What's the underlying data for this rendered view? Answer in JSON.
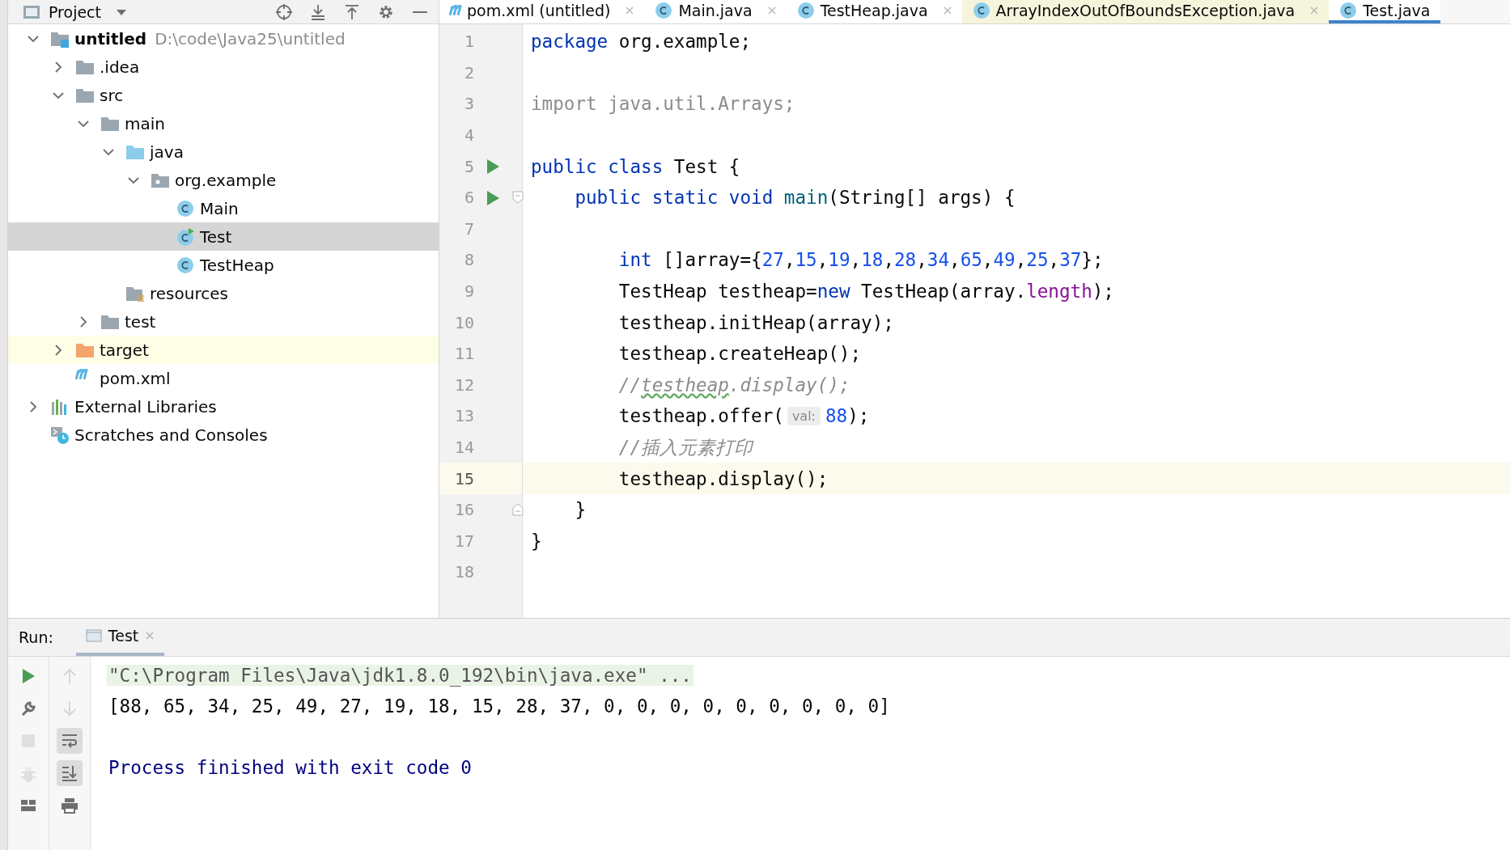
{
  "project_bar": {
    "title": "Project",
    "tools": [
      {
        "kind": "locate"
      },
      {
        "kind": "expand"
      },
      {
        "kind": "collapse"
      },
      {
        "kind": "settings"
      },
      {
        "kind": "hide"
      }
    ]
  },
  "tabs": [
    {
      "label": "pom.xml (untitled)",
      "kind": "maven",
      "selected": false,
      "closable": true,
      "color": "#ffffff"
    },
    {
      "label": "Main.java",
      "kind": "class",
      "selected": false,
      "closable": true,
      "color": "#ffffff"
    },
    {
      "label": "TestHeap.java",
      "kind": "class",
      "selected": false,
      "closable": true,
      "color": "#ffffff"
    },
    {
      "label": "ArrayIndexOutOfBoundsException.java",
      "kind": "class",
      "selected": false,
      "closable": true,
      "color": "#f6f5dc"
    },
    {
      "label": "Test.java",
      "kind": "class",
      "selected": true,
      "closable": false,
      "color": "#ffffff"
    }
  ],
  "tree": [
    {
      "label": "untitled",
      "path": "D:\\code\\Java25\\untitled",
      "kind": "module",
      "expanded": true,
      "selected": false,
      "highlighted": false,
      "children": [
        {
          "label": ".idea",
          "kind": "folder",
          "expanded": false,
          "selected": false,
          "highlighted": false
        },
        {
          "label": "src",
          "kind": "folder",
          "expanded": true,
          "selected": false,
          "highlighted": false,
          "children": [
            {
              "label": "main",
              "kind": "folder",
              "expanded": true,
              "selected": false,
              "highlighted": false,
              "children": [
                {
                  "label": "java",
                  "kind": "source-folder",
                  "expanded": true,
                  "selected": false,
                  "highlighted": false,
                  "children": [
                    {
                      "label": "org.example",
                      "kind": "package",
                      "expanded": true,
                      "selected": false,
                      "highlighted": false,
                      "children": [
                        {
                          "label": "Main",
                          "kind": "class",
                          "selected": false,
                          "highlighted": false
                        },
                        {
                          "label": "Test",
                          "kind": "runnable-class",
                          "selected": true,
                          "highlighted": false
                        },
                        {
                          "label": "TestHeap",
                          "kind": "class",
                          "selected": false,
                          "highlighted": false
                        }
                      ]
                    }
                  ]
                },
                {
                  "label": "resources",
                  "kind": "resources",
                  "selected": false,
                  "highlighted": false
                }
              ]
            },
            {
              "label": "test",
              "kind": "folder",
              "expanded": false,
              "selected": false,
              "highlighted": false
            }
          ]
        },
        {
          "label": "target",
          "kind": "excluded-folder",
          "expanded": false,
          "selected": false,
          "highlighted": true
        },
        {
          "label": "pom.xml",
          "kind": "maven",
          "selected": false,
          "highlighted": false
        }
      ]
    },
    {
      "label": "External Libraries",
      "kind": "libraries",
      "expanded": false,
      "selected": false,
      "highlighted": false
    },
    {
      "label": "Scratches and Consoles",
      "kind": "scratches",
      "selected": false,
      "highlighted": false
    }
  ],
  "editor": {
    "lines": [
      {
        "number": "1",
        "run": false,
        "fold_start": false,
        "fold_end": false,
        "current": false,
        "tokens": [
          {
            "text": "package",
            "kind": "kw"
          },
          {
            "text": " org.example;",
            "kind": "plain"
          }
        ]
      },
      {
        "number": "2",
        "run": false,
        "fold_start": false,
        "fold_end": false,
        "current": false
      },
      {
        "number": "3",
        "run": false,
        "fold_start": false,
        "fold_end": false,
        "current": false,
        "tokens": [
          {
            "text": "import java.util.Arrays;",
            "kind": "unused"
          }
        ]
      },
      {
        "number": "4",
        "run": false,
        "fold_start": false,
        "fold_end": false,
        "current": false
      },
      {
        "number": "5",
        "run": true,
        "fold_start": false,
        "fold_end": false,
        "current": false,
        "tokens": [
          {
            "text": "public class",
            "kind": "kw"
          },
          {
            "text": " Test {",
            "kind": "plain"
          }
        ]
      },
      {
        "number": "6",
        "run": true,
        "fold_start": true,
        "fold_end": false,
        "current": false,
        "tokens": [
          {
            "text": "    public static void",
            "kind": "kw"
          },
          {
            "text": " main",
            "kind": "decl"
          },
          {
            "text": "(String[] args) {",
            "kind": "plain"
          }
        ]
      },
      {
        "number": "7",
        "run": false,
        "fold_start": false,
        "fold_end": false,
        "current": false
      },
      {
        "number": "8",
        "run": false,
        "fold_start": false,
        "fold_end": false,
        "current": false,
        "tokens": [
          {
            "text": "        int",
            "kind": "kw"
          },
          {
            "text": " []array={",
            "kind": "plain"
          },
          {
            "text": "27",
            "kind": "num"
          },
          {
            "text": ",",
            "kind": "plain"
          },
          {
            "text": "15",
            "kind": "num"
          },
          {
            "text": ",",
            "kind": "plain"
          },
          {
            "text": "19",
            "kind": "num"
          },
          {
            "text": ",",
            "kind": "plain"
          },
          {
            "text": "18",
            "kind": "num"
          },
          {
            "text": ",",
            "kind": "plain"
          },
          {
            "text": "28",
            "kind": "num"
          },
          {
            "text": ",",
            "kind": "plain"
          },
          {
            "text": "34",
            "kind": "num"
          },
          {
            "text": ",",
            "kind": "plain"
          },
          {
            "text": "65",
            "kind": "num"
          },
          {
            "text": ",",
            "kind": "plain"
          },
          {
            "text": "49",
            "kind": "num"
          },
          {
            "text": ",",
            "kind": "plain"
          },
          {
            "text": "25",
            "kind": "num"
          },
          {
            "text": ",",
            "kind": "plain"
          },
          {
            "text": "37",
            "kind": "num"
          },
          {
            "text": "};",
            "kind": "plain"
          }
        ]
      },
      {
        "number": "9",
        "run": false,
        "fold_start": false,
        "fold_end": false,
        "current": false,
        "tokens": [
          {
            "text": "        TestHeap testheap=",
            "kind": "plain"
          },
          {
            "text": "new",
            "kind": "kw"
          },
          {
            "text": " TestHeap(array.",
            "kind": "plain"
          },
          {
            "text": "length",
            "kind": "field"
          },
          {
            "text": ");",
            "kind": "plain"
          }
        ]
      },
      {
        "number": "10",
        "run": false,
        "fold_start": false,
        "fold_end": false,
        "current": false,
        "tokens": [
          {
            "text": "        testheap.initHeap(array);",
            "kind": "plain"
          }
        ]
      },
      {
        "number": "11",
        "run": false,
        "fold_start": false,
        "fold_end": false,
        "current": false,
        "tokens": [
          {
            "text": "        testheap.createHeap();",
            "kind": "plain"
          }
        ]
      },
      {
        "number": "12",
        "run": false,
        "fold_start": false,
        "fold_end": false,
        "current": false,
        "tokens": [
          {
            "text": "        //",
            "kind": "comment"
          },
          {
            "text": "testheap",
            "kind": "typo"
          },
          {
            "text": ".display();",
            "kind": "comment"
          }
        ]
      },
      {
        "number": "13",
        "run": false,
        "fold_start": false,
        "fold_end": false,
        "current": false,
        "tokens": [
          {
            "text": "        testheap.offer(",
            "kind": "plain"
          },
          {
            "text": "val:",
            "kind": "hint"
          },
          {
            "text": "88",
            "kind": "num"
          },
          {
            "text": ");",
            "kind": "plain"
          }
        ]
      },
      {
        "number": "14",
        "run": false,
        "fold_start": false,
        "fold_end": false,
        "current": false,
        "tokens": [
          {
            "text": "        //插入元素打印",
            "kind": "comment"
          }
        ]
      },
      {
        "number": "15",
        "run": false,
        "fold_start": false,
        "fold_end": false,
        "current": true,
        "tokens": [
          {
            "text": "        testheap.display();",
            "kind": "plain"
          }
        ]
      },
      {
        "number": "16",
        "run": false,
        "fold_start": false,
        "fold_end": true,
        "current": false,
        "tokens": [
          {
            "text": "    }",
            "kind": "plain"
          }
        ]
      },
      {
        "number": "17",
        "run": false,
        "fold_start": false,
        "fold_end": false,
        "current": false,
        "tokens": [
          {
            "text": "}",
            "kind": "plain"
          }
        ]
      },
      {
        "number": "18",
        "run": false,
        "fold_start": false,
        "fold_end": false,
        "current": false
      }
    ]
  },
  "run_panel": {
    "label": "Run:",
    "tab": {
      "label": "Test",
      "selected": true
    },
    "tools_left": [
      {
        "kind": "run",
        "disabled": false
      },
      {
        "kind": "wrench",
        "disabled": false
      },
      {
        "kind": "stop",
        "disabled": true
      },
      {
        "kind": "debug",
        "disabled": true
      },
      {
        "kind": "layout",
        "disabled": false
      }
    ],
    "tools_right": [
      {
        "kind": "up",
        "disabled": true,
        "pressed": false
      },
      {
        "kind": "down",
        "disabled": true,
        "pressed": false
      },
      {
        "kind": "wrap",
        "disabled": false,
        "pressed": true
      },
      {
        "kind": "scroll-end",
        "disabled": false,
        "pressed": true
      },
      {
        "kind": "print",
        "disabled": false,
        "pressed": false
      }
    ],
    "output": [
      {
        "text": "\"C:\\Program Files\\Java\\jdk1.8.0_192\\bin\\java.exe\" ...",
        "kind": "command"
      },
      {
        "text": "[88, 65, 34, 25, 49, 27, 19, 18, 15, 28, 37, 0, 0, 0, 0, 0, 0, 0, 0, 0]",
        "kind": "stdout"
      },
      {
        "text": "Process finished with exit code 0",
        "kind": "exit"
      }
    ]
  }
}
